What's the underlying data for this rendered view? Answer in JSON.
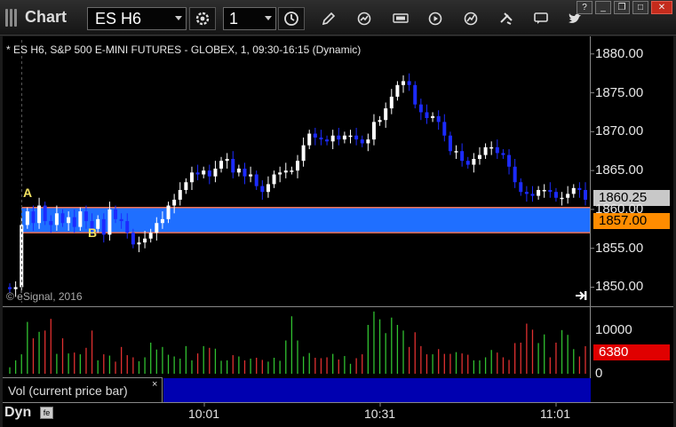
{
  "window": {
    "title": "Chart"
  },
  "toolbar": {
    "symbol": "ES H6",
    "interval": "1",
    "buttons": [
      {
        "name": "settings-icon"
      },
      {
        "name": "clock-icon"
      },
      {
        "name": "pencil-icon"
      },
      {
        "name": "refresh-icon"
      },
      {
        "name": "quote-icon"
      },
      {
        "name": "play-icon"
      },
      {
        "name": "tools-icon"
      },
      {
        "name": "chat-icon"
      },
      {
        "name": "twitter-icon"
      }
    ]
  },
  "chart": {
    "header": "* ES H6, S&P 500 E-MINI FUTURES - GLOBEX, 1, 09:30-16:15 (Dynamic)",
    "copyright": "© eSignal, 2016",
    "markers": {
      "a": "A",
      "b": "B"
    },
    "price_levels": {
      "upper": "1860.25",
      "lower": "1857.00"
    },
    "colors": {
      "band": "#1f6fff",
      "lower_tag": "#ff8c00",
      "upper_tag": "#c8c8c8",
      "up_bar": "#ffffff",
      "down_bar": "#1c2bff",
      "vol_down": "#e03030",
      "vol_up": "#30c030",
      "vol_tag": "#e00000"
    }
  },
  "volume_panel": {
    "label": "Vol (current price bar)",
    "close": "×",
    "value_tag": "6380"
  },
  "status": {
    "mode": "Dyn",
    "icon": "fe"
  },
  "chart_data": [
    {
      "type": "candlestick",
      "title": "* ES H6, S&P 500 E-MINI FUTURES - GLOBEX, 1, 09:30-16:15 (Dynamic)",
      "x_ticks": [
        "10:01",
        "10:31",
        "11:01"
      ],
      "y_ticks": [
        "1880.00",
        "1875.00",
        "1870.00",
        "1865.00",
        "1860.00",
        "1855.00",
        "1850.00"
      ],
      "ylim": [
        1848,
        1881.8
      ],
      "band": {
        "upper": 1860.25,
        "lower": 1857.0
      },
      "closes": [
        1849.75,
        1850.0,
        1858.0,
        1859.75,
        1858.25,
        1860.5,
        1858.5,
        1858.0,
        1859.5,
        1858.25,
        1859.0,
        1857.75,
        1859.75,
        1858.5,
        1857.5,
        1858.75,
        1856.75,
        1860.0,
        1858.75,
        1858.5,
        1857.0,
        1855.5,
        1855.75,
        1856.25,
        1857.0,
        1858.25,
        1858.75,
        1860.5,
        1861.25,
        1862.5,
        1863.5,
        1864.75,
        1864.5,
        1865.0,
        1864.25,
        1865.25,
        1866.25,
        1866.5,
        1864.75,
        1865.25,
        1864.25,
        1864.5,
        1863.0,
        1862.25,
        1863.25,
        1864.5,
        1864.75,
        1865.0,
        1865.0,
        1866.25,
        1868.25,
        1869.75,
        1869.25,
        1869.0,
        1868.75,
        1869.5,
        1869.0,
        1869.5,
        1869.5,
        1869.0,
        1868.5,
        1869.0,
        1871.25,
        1871.5,
        1873.0,
        1874.5,
        1876.0,
        1876.5,
        1876.0,
        1873.5,
        1872.5,
        1871.75,
        1872.0,
        1871.25,
        1869.5,
        1867.5,
        1867.5,
        1866.25,
        1865.75,
        1866.5,
        1867.0,
        1868.0,
        1868.0,
        1867.25,
        1867.0,
        1865.5,
        1863.5,
        1862.25,
        1862.0,
        1861.75,
        1862.5,
        1862.5,
        1862.25,
        1861.5,
        1861.5,
        1862.0,
        1862.75,
        1862.5,
        1861.25
      ]
    },
    {
      "type": "bar",
      "title": "Vol (current price bar)",
      "y_ticks": [
        "10000",
        "0"
      ],
      "ylim": [
        0,
        15000
      ],
      "values": [
        1500,
        3100,
        4500,
        12000,
        8200,
        9700,
        10000,
        12700,
        4600,
        8200,
        4700,
        4900,
        4500,
        6000,
        10000,
        3100,
        4500,
        4200,
        2800,
        6200,
        4300,
        3800,
        2900,
        3800,
        7200,
        5600,
        6200,
        4400,
        4000,
        3500,
        6400,
        3100,
        4700,
        6400,
        6000,
        5800,
        3000,
        3100,
        4300,
        4000,
        3100,
        3500,
        3700,
        3200,
        2800,
        3700,
        3000,
        7700,
        13300,
        7700,
        4000,
        4800,
        3700,
        3600,
        3800,
        4600,
        3300,
        4100,
        2300,
        3600,
        4500,
        11300,
        14400,
        12600,
        9400,
        13000,
        11300,
        10000,
        6200,
        9600,
        6400,
        4500,
        4500,
        5700,
        4600,
        4600,
        5000,
        4700,
        4400,
        3100,
        3100,
        3800,
        5500,
        4900,
        3800,
        3200,
        7100,
        7200,
        11600,
        10200,
        7100,
        9100,
        3800,
        7200,
        10100,
        9000,
        5700,
        4000,
        6380
      ]
    }
  ]
}
